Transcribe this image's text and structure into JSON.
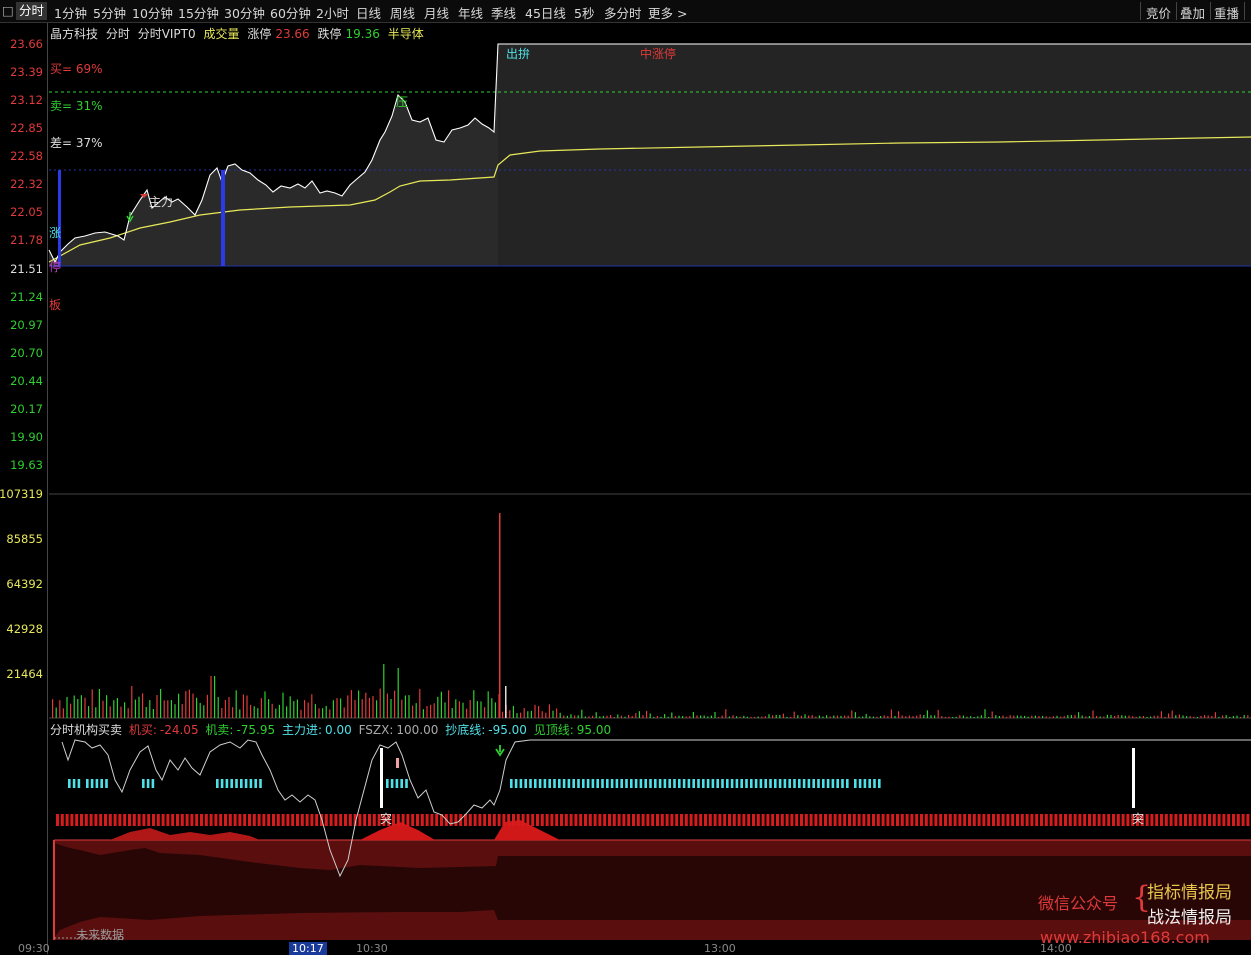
{
  "toolbar": {
    "corner": "□",
    "periods": [
      "分时",
      "1分钟",
      "5分钟",
      "10分钟",
      "15分钟",
      "30分钟",
      "60分钟",
      "2小时",
      "日线",
      "周线",
      "月线",
      "年线",
      "季线",
      "45日线",
      "5秒",
      "多分时",
      "更多 >"
    ],
    "right": [
      "竞价",
      "叠加",
      "重播"
    ]
  },
  "header": {
    "stock": "晶方科技",
    "mode1": "分时",
    "mode2": "分时VIPT0",
    "volume_label": "成交量",
    "limit_up_label": "涨停",
    "limit_up_value": "23.66",
    "limit_down_label": "跌停",
    "limit_down_value": "19.36",
    "sector": "半导体"
  },
  "price_axis": [
    "23.66",
    "23.39",
    "23.12",
    "22.85",
    "22.58",
    "22.32",
    "22.05",
    "21.78",
    "21.51",
    "21.24",
    "20.97",
    "20.70",
    "20.44",
    "20.17",
    "19.90",
    "19.63"
  ],
  "volume_axis": [
    "107319",
    "85855",
    "64392",
    "42928",
    "21464"
  ],
  "annotations": {
    "buy": "买= 69%",
    "sell": "卖= 31%",
    "diff": "差= 37%",
    "zhang": "涨",
    "ting": "停",
    "ban": "板",
    "zhuli": "主力",
    "ya": "压",
    "chufa": "出拚",
    "top_red": "中涨停"
  },
  "indicator": {
    "name": "分时机构买卖",
    "jimai_label": "机买:",
    "jimai_value": "-24.05",
    "jimaichu_label": "机卖:",
    "jimaichu_value": "-75.95",
    "zhuli_label": "主力进:",
    "zhuli_value": "0.00",
    "fszx_label": "FSZX:",
    "fszx_value": "100.00",
    "chaodi_label": "抄底线:",
    "chaodi_value": "-95.00",
    "jianding_label": "见顶线:",
    "jianding_value": "95.00",
    "tu1": "突",
    "tu2": "突",
    "future": "未来数据"
  },
  "xaxis": {
    "t0930": "09:30",
    "current": "10:17",
    "t1030": "10:30",
    "t1300": "13:00",
    "t1400": "14:00"
  },
  "watermark": {
    "wechat": "微信公众号",
    "brace": "{",
    "name1": "指标情报局",
    "name2": "战法情报局",
    "url": "www.zhibiao168.com"
  },
  "colors": {
    "up": "#e03a3a",
    "down": "#2fcf2f",
    "avg_line": "#e8e85a",
    "price_line": "#ffffff",
    "accent_cyan": "#4fe0e8"
  }
}
